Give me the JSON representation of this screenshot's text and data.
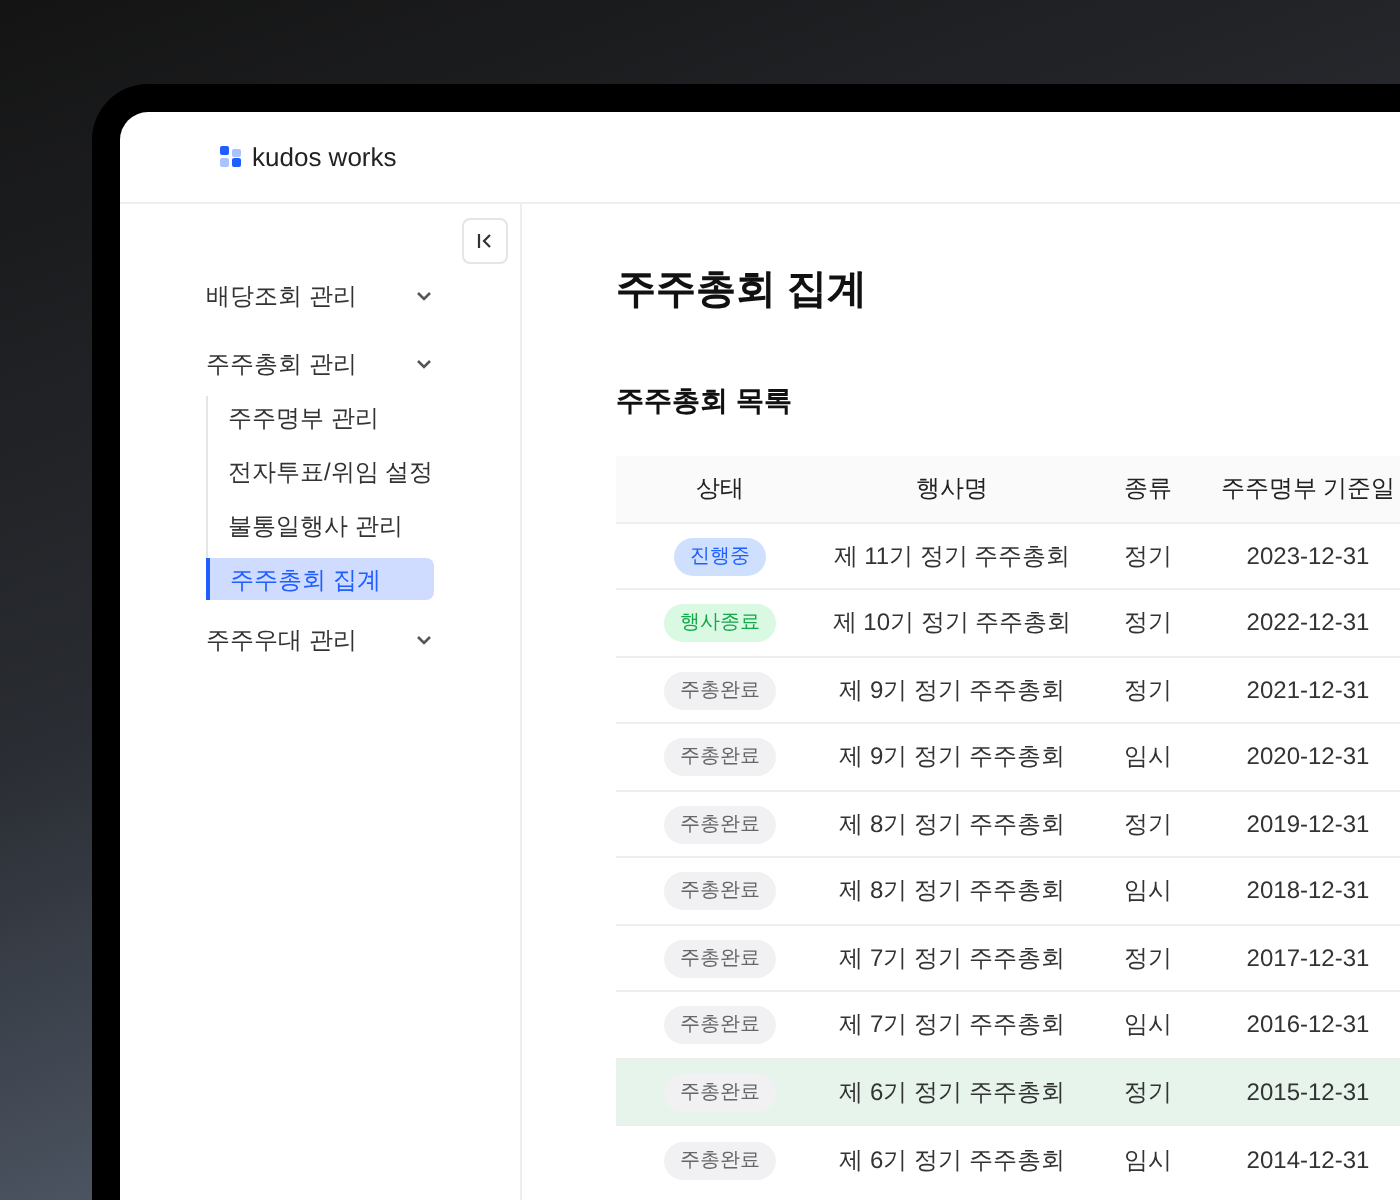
{
  "brand": {
    "name": "kudos works"
  },
  "sidebar": {
    "items": [
      {
        "label": "배당조회 관리"
      },
      {
        "label": "주주총회 관리",
        "children": [
          {
            "label": "주주명부 관리",
            "selected": false
          },
          {
            "label": "전자투표/위임 설정",
            "selected": false
          },
          {
            "label": "불통일행사 관리",
            "selected": false
          },
          {
            "label": "주주총회 집계",
            "selected": true
          }
        ]
      },
      {
        "label": "주주우대 관리"
      }
    ]
  },
  "page": {
    "title": "주주총회 집계",
    "section_title": "주주총회 목록"
  },
  "table": {
    "columns": [
      "상태",
      "행사명",
      "종류",
      "주주명부 기준일"
    ],
    "rows": [
      {
        "status": "진행중",
        "kind": "in_progress",
        "name": "제 11기 정기 주주총회",
        "type": "정기",
        "date": "2023-12-31",
        "selected": false
      },
      {
        "status": "행사종료",
        "kind": "ended",
        "name": "제 10기 정기 주주총회",
        "type": "정기",
        "date": "2022-12-31",
        "selected": false
      },
      {
        "status": "주총완료",
        "kind": "done",
        "name": "제 9기 정기 주주총회",
        "type": "정기",
        "date": "2021-12-31",
        "selected": false
      },
      {
        "status": "주총완료",
        "kind": "done",
        "name": "제 9기 정기 주주총회",
        "type": "임시",
        "date": "2020-12-31",
        "selected": false
      },
      {
        "status": "주총완료",
        "kind": "done",
        "name": "제 8기 정기 주주총회",
        "type": "정기",
        "date": "2019-12-31",
        "selected": false
      },
      {
        "status": "주총완료",
        "kind": "done",
        "name": "제 8기 정기 주주총회",
        "type": "임시",
        "date": "2018-12-31",
        "selected": false
      },
      {
        "status": "주총완료",
        "kind": "done",
        "name": "제 7기 정기 주주총회",
        "type": "정기",
        "date": "2017-12-31",
        "selected": false
      },
      {
        "status": "주총완료",
        "kind": "done",
        "name": "제 7기 정기 주주총회",
        "type": "임시",
        "date": "2016-12-31",
        "selected": false
      },
      {
        "status": "주총완료",
        "kind": "done",
        "name": "제 6기 정기 주주총회",
        "type": "정기",
        "date": "2015-12-31",
        "selected": true
      },
      {
        "status": "주총완료",
        "kind": "done",
        "name": "제 6기 정기 주주총회",
        "type": "임시",
        "date": "2014-12-31",
        "selected": false
      }
    ]
  }
}
